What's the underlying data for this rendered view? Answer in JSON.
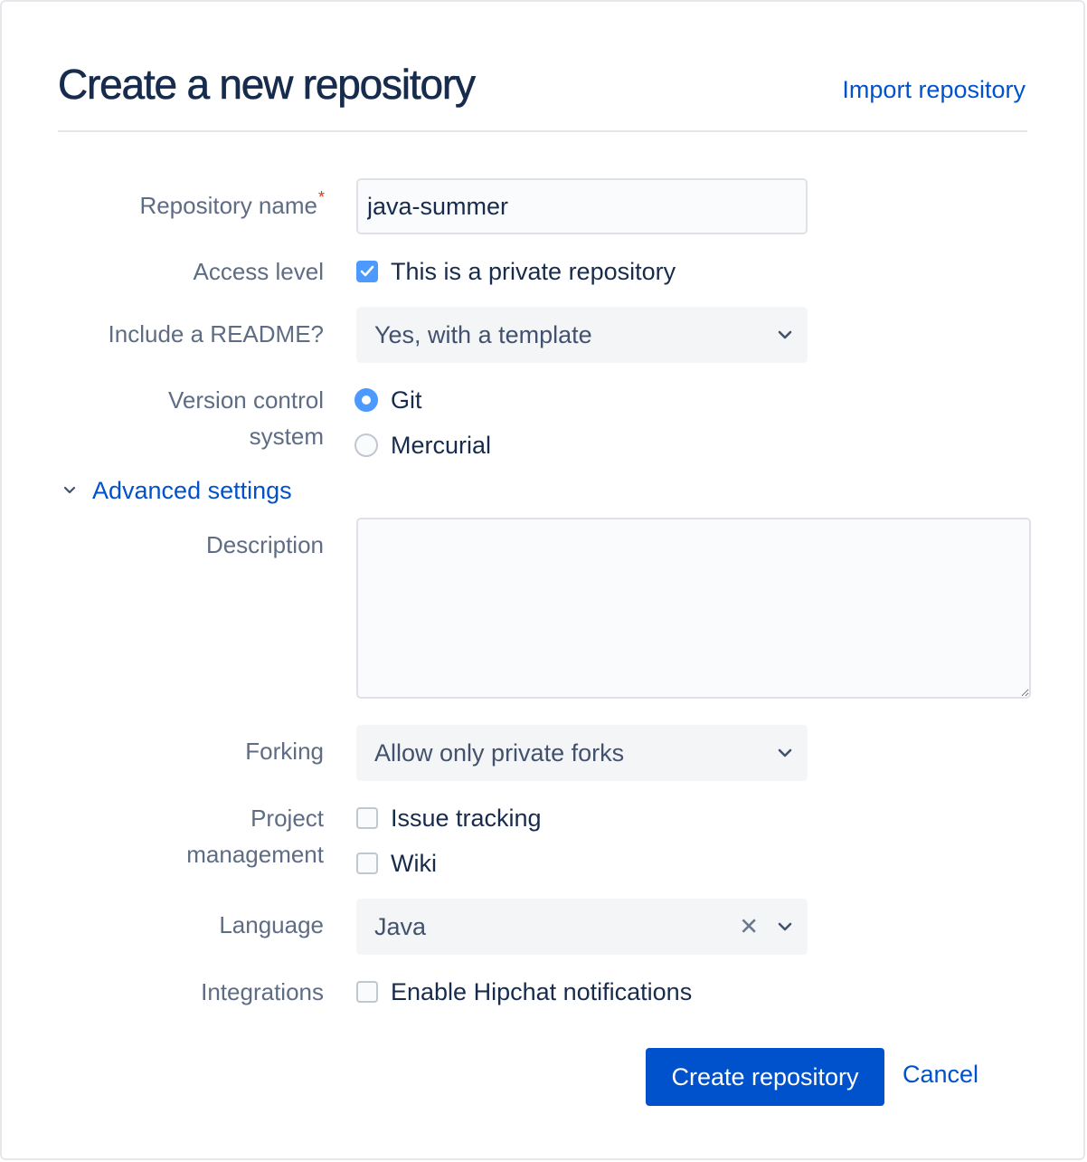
{
  "header": {
    "title": "Create a new repository",
    "import_link": "Import repository"
  },
  "form": {
    "repository_name": {
      "label": "Repository name",
      "required_mark": "*",
      "value": "java-summer"
    },
    "access_level": {
      "label": "Access level",
      "checkbox_label": "This is a private repository",
      "checked": true
    },
    "readme": {
      "label": "Include a README?",
      "selected": "Yes, with a template"
    },
    "vcs": {
      "label_line1": "Version control",
      "label_line2": "system",
      "options": [
        {
          "label": "Git",
          "selected": true
        },
        {
          "label": "Mercurial",
          "selected": false
        }
      ]
    },
    "advanced_toggle": "Advanced settings",
    "description": {
      "label": "Description",
      "value": ""
    },
    "forking": {
      "label": "Forking",
      "selected": "Allow only private forks"
    },
    "project_management": {
      "label_line1": "Project",
      "label_line2": "management",
      "options": [
        {
          "label": "Issue tracking",
          "checked": false
        },
        {
          "label": "Wiki",
          "checked": false
        }
      ]
    },
    "language": {
      "label": "Language",
      "selected": "Java"
    },
    "integrations": {
      "label": "Integrations",
      "checkbox_label": "Enable Hipchat notifications",
      "checked": false
    }
  },
  "actions": {
    "create_label": "Create repository",
    "cancel_label": "Cancel"
  },
  "colors": {
    "primary": "#0052cc",
    "checked": "#4c9aff",
    "label": "#5e6c84",
    "text": "#172b4d"
  }
}
